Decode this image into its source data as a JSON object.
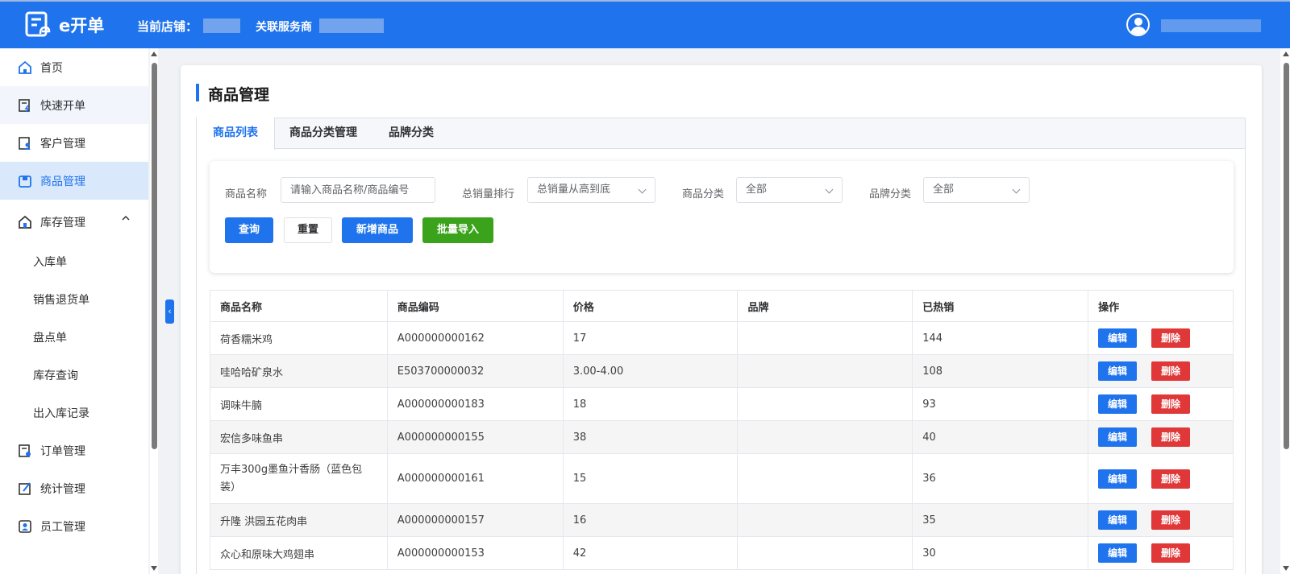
{
  "header": {
    "app_name": "e开单",
    "store_label": "当前店铺：",
    "provider_label": "关联服务商"
  },
  "sidebar": {
    "items": [
      {
        "label": "首页",
        "icon": "home-icon"
      },
      {
        "label": "快速开单",
        "icon": "quick-bill-icon"
      },
      {
        "label": "客户管理",
        "icon": "customer-icon"
      },
      {
        "label": "商品管理",
        "icon": "goods-icon"
      },
      {
        "label": "库存管理",
        "icon": "warehouse-icon"
      },
      {
        "label": "入库单"
      },
      {
        "label": "销售退货单"
      },
      {
        "label": "盘点单"
      },
      {
        "label": "库存查询"
      },
      {
        "label": "出入库记录"
      },
      {
        "label": "订单管理",
        "icon": "order-icon"
      },
      {
        "label": "统计管理",
        "icon": "stats-icon"
      },
      {
        "label": "员工管理",
        "icon": "staff-icon"
      }
    ]
  },
  "page": {
    "title": "商品管理",
    "tabs": [
      "商品列表",
      "商品分类管理",
      "品牌分类"
    ]
  },
  "filters": {
    "name_label": "商品名称",
    "name_placeholder": "请输入商品名称/商品编号",
    "sales_label": "总销量排行",
    "sales_value": "总销量从高到底",
    "category_label": "商品分类",
    "category_value": "全部",
    "brand_label": "品牌分类",
    "brand_value": "全部",
    "buttons": {
      "query": "查询",
      "reset": "重置",
      "add": "新增商品",
      "import": "批量导入"
    }
  },
  "table": {
    "columns": [
      "商品名称",
      "商品编码",
      "价格",
      "品牌",
      "已热销",
      "操作"
    ],
    "edit_label": "编辑",
    "delete_label": "删除",
    "rows": [
      {
        "name": "荷香糯米鸡",
        "code": "A000000000162",
        "price": "17",
        "brand": "",
        "sold": "144"
      },
      {
        "name": "哇哈哈矿泉水",
        "code": "E503700000032",
        "price": "3.00-4.00",
        "brand": "",
        "sold": "108"
      },
      {
        "name": "调味牛腩",
        "code": "A000000000183",
        "price": "18",
        "brand": "",
        "sold": "93"
      },
      {
        "name": "宏信多味鱼串",
        "code": "A000000000155",
        "price": "38",
        "brand": "",
        "sold": "40"
      },
      {
        "name": "万丰300g墨鱼汁香肠（蓝色包装）",
        "code": "A000000000161",
        "price": "15",
        "brand": "",
        "sold": "36"
      },
      {
        "name": "升隆 洪园五花肉串",
        "code": "A000000000157",
        "price": "16",
        "brand": "",
        "sold": "35"
      },
      {
        "name": "众心和原味大鸡翅串",
        "code": "A000000000153",
        "price": "42",
        "brand": "",
        "sold": "30"
      }
    ]
  }
}
